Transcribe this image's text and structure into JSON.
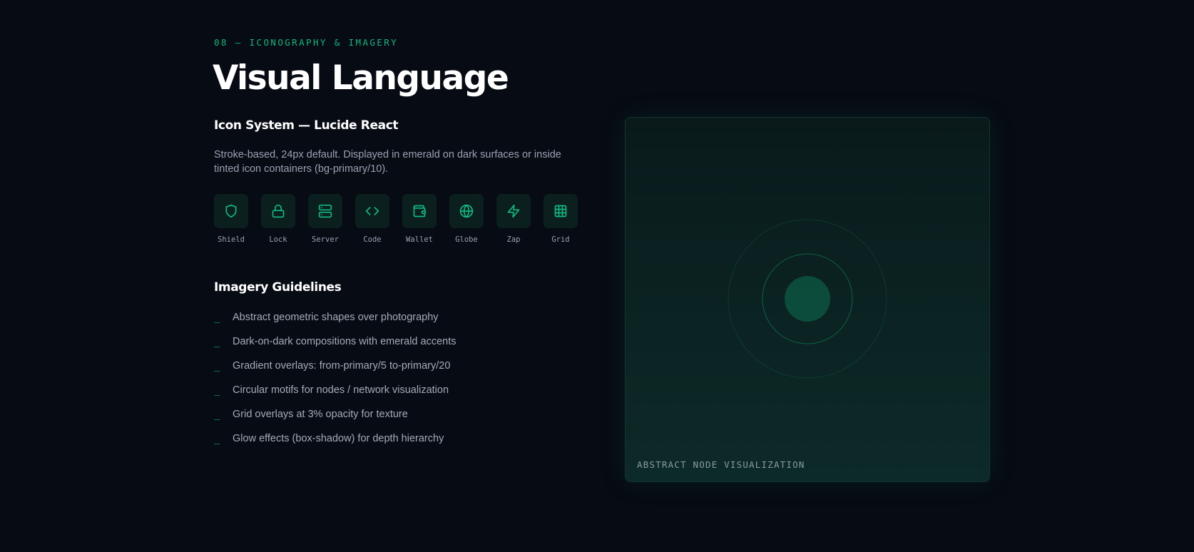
{
  "section": {
    "eyebrow": "08 — ICONOGRAPHY & IMAGERY",
    "title": "Visual Language"
  },
  "icon_system": {
    "heading": "Icon System — Lucide React",
    "description": "Stroke-based, 24px default. Displayed in emerald on dark surfaces or inside tinted icon containers (bg-primary/10).",
    "icons": [
      {
        "label": "Shield",
        "icon": "shield-icon"
      },
      {
        "label": "Lock",
        "icon": "lock-icon"
      },
      {
        "label": "Server",
        "icon": "server-icon"
      },
      {
        "label": "Code",
        "icon": "code-icon"
      },
      {
        "label": "Wallet",
        "icon": "wallet-icon"
      },
      {
        "label": "Globe",
        "icon": "globe-icon"
      },
      {
        "label": "Zap",
        "icon": "zap-icon"
      },
      {
        "label": "Grid",
        "icon": "grid-icon"
      }
    ]
  },
  "imagery": {
    "heading": "Imagery Guidelines",
    "marker": "_",
    "items": [
      "Abstract geometric shapes over photography",
      "Dark-on-dark compositions with emerald accents",
      "Gradient overlays: from-primary/5 to-primary/20",
      "Circular motifs for nodes / network visualization",
      "Grid overlays at 3% opacity for texture",
      "Glow effects (box-shadow) for depth hierarchy"
    ]
  },
  "visualization": {
    "caption": "ABSTRACT NODE VISUALIZATION"
  },
  "colors": {
    "background": "#070b13",
    "accent": "#10b981",
    "text_muted": "#98a2b3",
    "panel": "#0c2a28"
  }
}
